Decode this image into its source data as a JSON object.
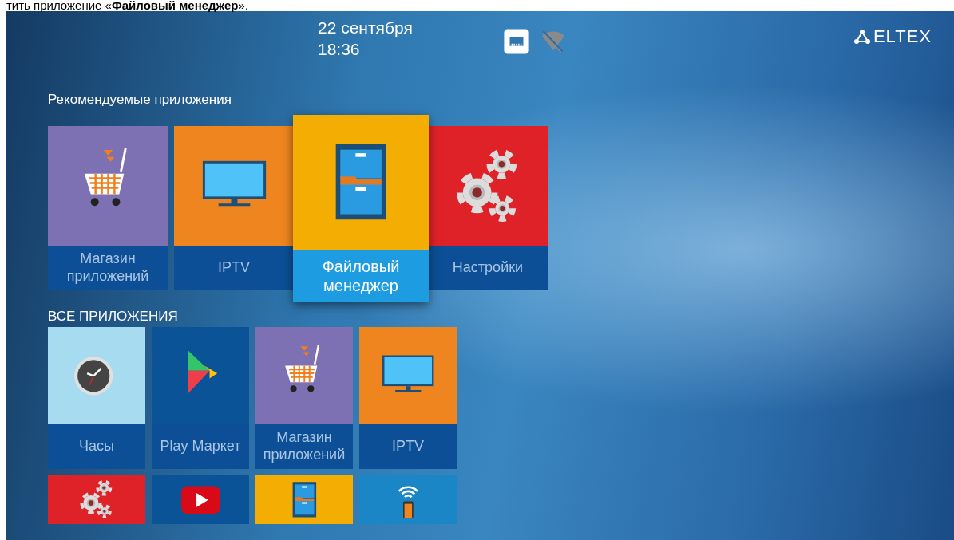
{
  "doc_text": "тить приложение «**Файловый менеджер**».",
  "header": {
    "date": "22 сентября",
    "time": "18:36",
    "logo": "ELTEX"
  },
  "recommended": {
    "title": "Рекомендуемые приложения",
    "apps": [
      {
        "label": "Магазин приложений",
        "kind": "store",
        "selected": false
      },
      {
        "label": "IPTV",
        "kind": "tv",
        "selected": false
      },
      {
        "label": "Файловый менеджер",
        "kind": "files",
        "selected": true
      },
      {
        "label": "Настройки",
        "kind": "settings",
        "selected": false
      }
    ]
  },
  "all_apps": {
    "title": "ВСЕ ПРИЛОЖЕНИЯ",
    "apps": [
      {
        "label": "Часы",
        "kind": "clock"
      },
      {
        "label": "Play Маркет",
        "kind": "play"
      },
      {
        "label": "Магазин приложений",
        "kind": "store"
      },
      {
        "label": "IPTV",
        "kind": "tv"
      },
      {
        "kind": "settings"
      },
      {
        "kind": "video"
      },
      {
        "kind": "files"
      },
      {
        "kind": "remote"
      }
    ]
  }
}
